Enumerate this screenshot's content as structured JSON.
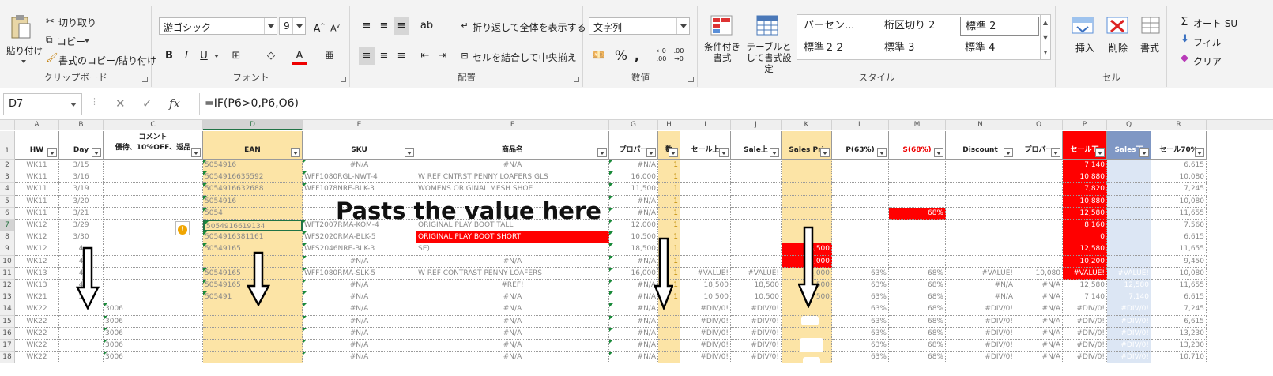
{
  "ribbon": {
    "clipboard": {
      "paste": "貼り付け",
      "cut": "切り取り",
      "copy": "コピー",
      "format_painter": "書式のコピー/貼り付け",
      "label": "クリップボード"
    },
    "font": {
      "name": "游ゴシック",
      "size": "9",
      "bold": "B",
      "italic": "I",
      "underline": "U",
      "label": "フォント"
    },
    "alignment": {
      "wrap": "折り返して全体を表示する",
      "merge": "セルを結合して中央揃え",
      "label": "配置"
    },
    "number": {
      "format": "文字列",
      "percent": "%",
      "label": "数値"
    },
    "styles": {
      "conditional": "条件付き書式",
      "table": "テーブルとして書式設定",
      "cells": [
        "パーセン...",
        "桁区切り 2",
        "標準 2",
        "標準２２",
        "標準 3",
        "標準 4"
      ],
      "label": "スタイル"
    },
    "cells_group": {
      "insert": "挿入",
      "delete": "削除",
      "format": "書式",
      "label": "セル"
    },
    "editing": {
      "autosum": "オート SU",
      "fill": "フィル",
      "clear": "クリア"
    }
  },
  "formula_bar": {
    "name_box": "D7",
    "cancel": "✕",
    "enter": "✓",
    "fx": "fx",
    "formula": "=IF(P6>0,P6,O6)"
  },
  "columns": [
    "A",
    "B",
    "C",
    "D",
    "E",
    "F",
    "G",
    "H",
    "I",
    "J",
    "K",
    "L",
    "M",
    "N",
    "O",
    "P",
    "Q",
    "R"
  ],
  "selected_column": "D",
  "header_row": {
    "A": "HW",
    "B": "Day",
    "C_top": "コメント",
    "C": "優待、10%OFF、返品",
    "D": "EAN",
    "E": "SKU",
    "F": "商品名",
    "G": "プロパー",
    "H": "数",
    "I": "セール上",
    "J": "Sale上",
    "K": "Sales Pri",
    "L": "P(63%)",
    "M": "S(68%)",
    "N": "Discount",
    "O": "プロパー",
    "P": "セール下",
    "Q": "Sales下",
    "R": "セール70%"
  },
  "rows": [
    {
      "n": "2",
      "A": "WK11",
      "B": "3/15",
      "D": "5054916",
      "E": "#N/A",
      "F": "#N/A",
      "G": "#N/A",
      "H": "1",
      "P": "7,140",
      "R": "6,615"
    },
    {
      "n": "3",
      "A": "WK11",
      "B": "3/16",
      "D": "5054916635592",
      "E": "WFF1080RGL-NWT-4",
      "F": "W REF CNTRST PENNY LOAFERS GLS",
      "G": "16,000",
      "H": "1",
      "P": "10,880",
      "R": "10,080"
    },
    {
      "n": "4",
      "A": "WK11",
      "B": "3/19",
      "D": "5054916632688",
      "E": "WFF1078NRE-BLK-3",
      "F": "WOMENS ORIGINAL MESH SHOE",
      "G": "11,500",
      "H": "1",
      "P": "7,820",
      "R": "7,245"
    },
    {
      "n": "5",
      "A": "WK11",
      "B": "3/20",
      "D": "5054916",
      "E": "",
      "F": "",
      "G": "#N/A",
      "H": "1",
      "P": "10,880",
      "R": "10,080"
    },
    {
      "n": "6",
      "A": "WK11",
      "B": "3/21",
      "D": "5054",
      "E": "",
      "F": "",
      "G": "#N/A",
      "H": "1",
      "M": "68%",
      "P": "12,580",
      "R": "11,655"
    },
    {
      "n": "7",
      "A": "WK12",
      "B": "3/29",
      "D": "5054916619134",
      "E": "WFT2007RMA-KOM-4",
      "F": "ORIGINAL PLAY BOOT TALL",
      "G": "12,000",
      "H": "1",
      "P": "8,160",
      "R": "7,560"
    },
    {
      "n": "8",
      "A": "WK12",
      "B": "3/30",
      "D": "5054916381161",
      "E": "WFS2020RMA-BLK-5",
      "F": "ORIGINAL PLAY BOOT SHORT",
      "G": "10,500",
      "H": "1",
      "P": "0",
      "R": "6,615"
    },
    {
      "n": "9",
      "A": "WK12",
      "B": "4",
      "D": "50549165",
      "E": "WFS2046NRE-BLK-3",
      "F": "SE)",
      "G": "18,500",
      "H": "1",
      "K": "18,500",
      "P": "12,580",
      "R": "11,655"
    },
    {
      "n": "10",
      "A": "WK12",
      "B": "4",
      "D": "",
      "E": "#N/A",
      "F": "#N/A",
      "G": "#N/A",
      "H": "1",
      "K": "15,000",
      "P": "10,200",
      "R": "9,450"
    },
    {
      "n": "11",
      "A": "WK13",
      "B": "4",
      "D": "50549165",
      "E": "WFF1080RMA-SLK-5",
      "F": "W REF CONTRAST PENNY LOAFERS",
      "G": "16,000",
      "H": "1",
      "I": "#VALUE!",
      "J": "#VALUE!",
      "K": "16,000",
      "L": "63%",
      "M": "68%",
      "N": "#VALUE!",
      "O": "10,080",
      "P": "#VALUE!",
      "Q": "#VALUE!",
      "R": "10,080"
    },
    {
      "n": "12",
      "A": "WK13",
      "B": "4",
      "D": "50549165",
      "E": "#N/A",
      "F": "#REF!",
      "G": "#N/A",
      "H": "1",
      "I": "18,500",
      "J": "18,500",
      "K": "18,500",
      "L": "63%",
      "M": "68%",
      "N": "#N/A",
      "O": "#N/A",
      "P": "12,580",
      "Q": "12,580",
      "R": "11,655"
    },
    {
      "n": "13",
      "A": "WK21",
      "B": "5",
      "D": "505491",
      "E": "#N/A",
      "F": "#N/A",
      "G": "#N/A",
      "H": "1",
      "I": "10,500",
      "J": "10,500",
      "K": "10,500",
      "L": "63%",
      "M": "68%",
      "N": "#N/A",
      "O": "#N/A",
      "P": "7,140",
      "Q": "7,140",
      "R": "6,615"
    },
    {
      "n": "14",
      "A": "WK22",
      "B": "",
      "C": "3006",
      "D": "",
      "E": "#N/A",
      "F": "#N/A",
      "G": "#N/A",
      "H": "",
      "I": "#DIV/0!",
      "J": "#DIV/0!",
      "K": "",
      "L": "63%",
      "M": "68%",
      "N": "#DIV/0!",
      "O": "#N/A",
      "P": "#DIV/0!",
      "Q": "#DIV/0!",
      "R": "7,245"
    },
    {
      "n": "15",
      "A": "WK22",
      "B": "",
      "C": "3006",
      "D": "",
      "E": "#N/A",
      "F": "#N/A",
      "G": "#N/A",
      "H": "",
      "I": "#DIV/0!",
      "J": "#DIV/0!",
      "K": "",
      "L": "63%",
      "M": "68%",
      "N": "#DIV/0!",
      "O": "#N/A",
      "P": "#DIV/0!",
      "Q": "#DIV/0!",
      "R": "6,615"
    },
    {
      "n": "16",
      "A": "WK22",
      "B": "",
      "C": "3006",
      "D": "",
      "E": "#N/A",
      "F": "#N/A",
      "G": "#N/A",
      "H": "",
      "I": "#DIV/0!",
      "J": "#DIV/0!",
      "K": "",
      "L": "63%",
      "M": "68%",
      "N": "#DIV/0!",
      "O": "#N/A",
      "P": "#DIV/0!",
      "Q": "#DIV/0!",
      "R": "13,230"
    },
    {
      "n": "17",
      "A": "WK22",
      "B": "",
      "C": "3006",
      "D": "",
      "E": "#N/A",
      "F": "#N/A",
      "G": "#N/A",
      "H": "",
      "I": "#DIV/0!",
      "J": "#DIV/0!",
      "K": "",
      "L": "63%",
      "M": "68%",
      "N": "#DIV/0!",
      "O": "#N/A",
      "P": "#DIV/0!",
      "Q": "#DIV/0!",
      "R": "13,230"
    },
    {
      "n": "18",
      "A": "WK22",
      "B": "",
      "C": "3006",
      "D": "",
      "E": "#N/A",
      "F": "#N/A",
      "G": "#N/A",
      "H": "",
      "I": "#DIV/0!",
      "J": "#DIV/0!",
      "K": "",
      "L": "63%",
      "M": "68%",
      "N": "#DIV/0!",
      "O": "#N/A",
      "P": "#DIV/0!",
      "Q": "#DIV/0!",
      "R": "10,710"
    }
  ],
  "annotation": "Pasts the value here",
  "colors": {
    "accent_green": "#217346",
    "highlight_yellow": "#fce4a6",
    "error_red": "#ff0000",
    "light_blue": "#dce6f4"
  }
}
